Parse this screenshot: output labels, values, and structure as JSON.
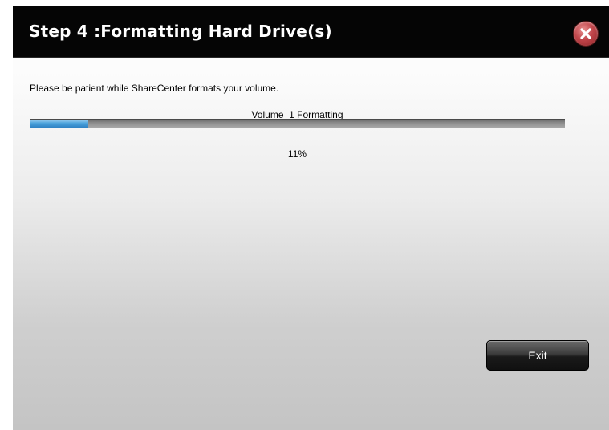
{
  "dialog": {
    "title": "Step 4 :Formatting Hard Drive(s)",
    "close_icon": "close-icon"
  },
  "content": {
    "message": "Please be patient while ShareCenter formats your volume.",
    "volume_label": "Volume_1 Formatting",
    "progress_percent": 11,
    "progress_text": "11%"
  },
  "footer": {
    "exit_label": "Exit"
  },
  "colors": {
    "titlebar": "#050505",
    "progress_fill": "#4da3dc",
    "close_red": "#c0454a"
  }
}
